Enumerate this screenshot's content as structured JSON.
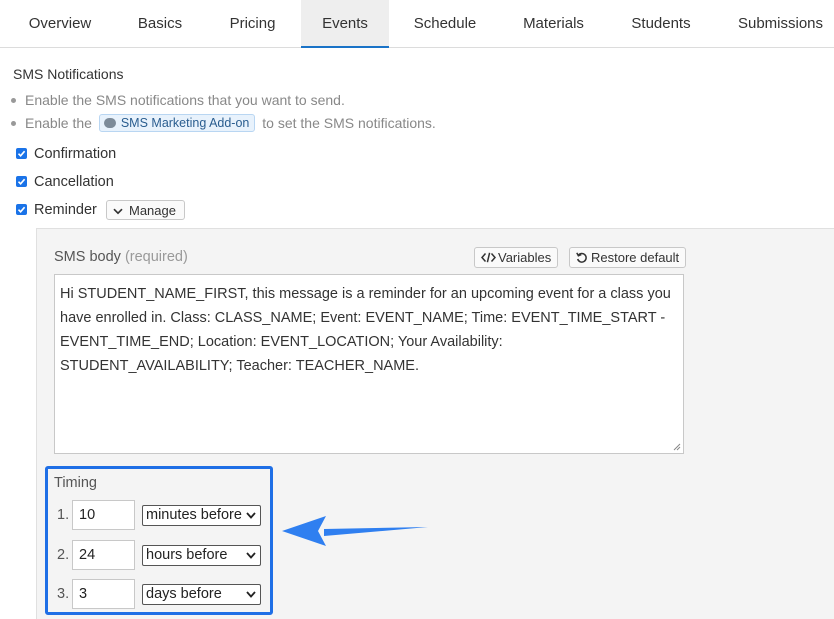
{
  "tabs": [
    {
      "label": "Overview"
    },
    {
      "label": "Basics"
    },
    {
      "label": "Pricing"
    },
    {
      "label": "Events",
      "active": true
    },
    {
      "label": "Schedule"
    },
    {
      "label": "Materials"
    },
    {
      "label": "Students"
    },
    {
      "label": "Submissions"
    }
  ],
  "section_title": "SMS Notifications",
  "bullets": {
    "line1": "Enable the SMS notifications that you want to send.",
    "line2_prefix": "Enable the",
    "addon_label": "SMS Marketing Add-on",
    "line2_suffix": "to set the SMS notifications."
  },
  "checkboxes": [
    {
      "label": "Confirmation",
      "checked": true
    },
    {
      "label": "Cancellation",
      "checked": true
    },
    {
      "label": "Reminder",
      "checked": true
    }
  ],
  "manage_label": "Manage",
  "sms": {
    "label": "SMS body",
    "required": "(required)",
    "variables_label": "Variables",
    "restore_label": "Restore default",
    "body": "Hi STUDENT_NAME_FIRST, this message is a reminder for an upcoming event for a class you have enrolled in. Class: CLASS_NAME; Event: EVENT_NAME; Time: EVENT_TIME_START - EVENT_TIME_END; Location: EVENT_LOCATION; Your Availability: STUDENT_AVAILABILITY; Teacher: TEACHER_NAME."
  },
  "timing": {
    "title": "Timing",
    "rows": [
      {
        "num": "1.",
        "value": "10",
        "unit": "minutes before"
      },
      {
        "num": "2.",
        "value": "24",
        "unit": "hours before"
      },
      {
        "num": "3.",
        "value": "3",
        "unit": "days before"
      }
    ]
  },
  "colors": {
    "accent": "#1a73c7",
    "highlight_box": "#1f6fe6",
    "arrow": "#2f7ff0"
  }
}
